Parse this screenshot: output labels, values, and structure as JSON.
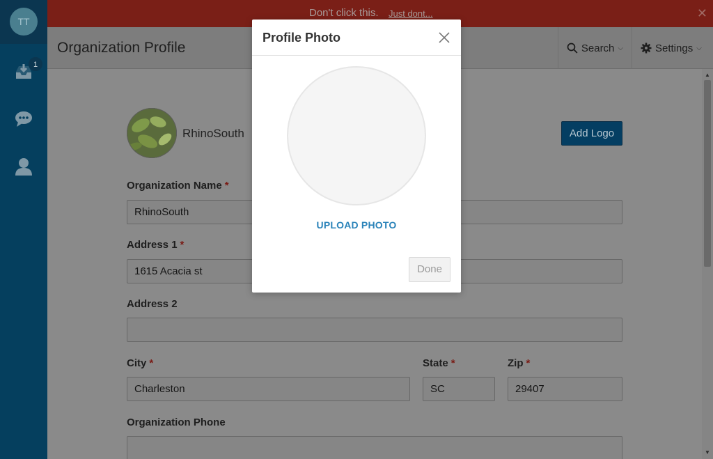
{
  "sidebar": {
    "avatar_initials": "TT",
    "inbox_badge": "1",
    "items": [
      {
        "icon": "inbox-icon"
      },
      {
        "icon": "chat-icon"
      },
      {
        "icon": "user-icon"
      }
    ]
  },
  "banner": {
    "text": "Don't click this.",
    "link": "Just dont...",
    "close_icon": "close-icon"
  },
  "header": {
    "title": "Organization Profile",
    "search_label": "Search",
    "settings_label": "Settings"
  },
  "profile": {
    "org_display_name": "RhinoSouth",
    "add_logo_label": "Add Logo"
  },
  "form": {
    "org_name_label": "Organization Name",
    "org_name_value": "RhinoSouth",
    "address1_label": "Address 1",
    "address1_value": "1615 Acacia st",
    "address2_label": "Address 2",
    "address2_value": "",
    "city_label": "City",
    "city_value": "Charleston",
    "state_label": "State",
    "state_value": "SC",
    "zip_label": "Zip",
    "zip_value": "29407",
    "phone_label": "Organization Phone",
    "phone_value": "",
    "required_mark": "*"
  },
  "modal": {
    "title": "Profile Photo",
    "upload_label": "UPLOAD PHOTO",
    "done_label": "Done"
  },
  "colors": {
    "sidebar": "#053f5e",
    "banner": "#7a1f17",
    "accent": "#2a83b9",
    "required": "#7a1b15"
  }
}
